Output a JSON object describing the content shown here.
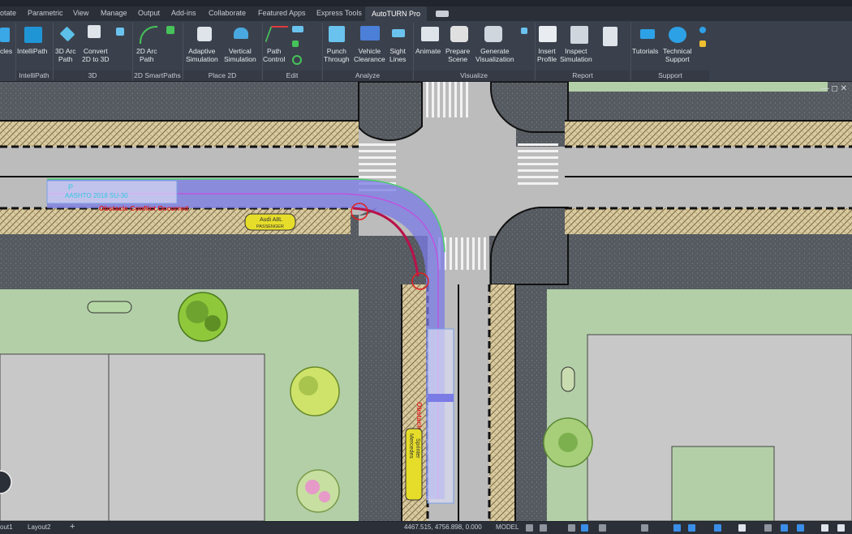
{
  "tabs": [
    "otate",
    "Parametric",
    "View",
    "Manage",
    "Output",
    "Add-ins",
    "Collaborate",
    "Featured Apps",
    "Express Tools",
    "AutoTURN Pro"
  ],
  "ribbon": {
    "vehicles": "cles",
    "intellipath": "IntelliPath",
    "arc3d_1": "3D Arc",
    "arc3d_2": "Path",
    "convert_1": "Convert",
    "convert_2": "2D to 3D",
    "arc2d_1": "2D Arc",
    "arc2d_2": "Path",
    "adaptive_1": "Adaptive",
    "adaptive_2": "Simulation",
    "vertical_1": "Vertical",
    "vertical_2": "Simulation",
    "pathctl_1": "Path",
    "pathctl_2": "Control",
    "punch_1": "Punch",
    "punch_2": "Through",
    "vclear_1": "Vehicle",
    "vclear_2": "Clearance",
    "sight_1": "Sight",
    "sight_2": "Lines",
    "animate": "Animate",
    "prepare_1": "Prepare",
    "prepare_2": "Scene",
    "generate_1": "Generate",
    "generate_2": "Visualization",
    "insert_1": "Insert",
    "insert_2": "Profile",
    "inspect_1": "Inspect",
    "inspect_2": "Simulation",
    "tutorials": "Tutorials",
    "tech_1": "Technical",
    "tech_2": "Support"
  },
  "groups": {
    "intellipath": "IntelliPath",
    "g3d": "3D",
    "smart2d": "2D SmartPaths",
    "place2d": "Place 2D",
    "edit": "Edit",
    "analyze": "Analyze",
    "visualize": "Visualize",
    "report": "Report",
    "support": "Support"
  },
  "drawing": {
    "vehicle_upper_label": "AASHTO 2018 SU-30",
    "vehicle_upper_mark": "P",
    "obstacle_msg": "Obstacle Conflict Occurred",
    "car1_line1": "Audi A8L",
    "car1_line2": "PASSENGER",
    "car2_line1": "Mercedes",
    "car2_line2": "Sprinter",
    "vertical_msg": "Obstacle Conflict Occurred"
  },
  "status": {
    "layout1": "out1",
    "layout2": "Layout2",
    "plus": "+",
    "coords": "4467.515, 4756.898, 0.000",
    "model": "MODEL"
  },
  "colors": {
    "ribbon_bg": "#3b414c",
    "lawn": "#b3cfa7",
    "sidewalk": "#cfc19e",
    "road": "#bcbcbc",
    "swept_path": "#7b7be6",
    "conflict": "#e0201f",
    "vehicle_yellow": "#e6dd2a"
  }
}
